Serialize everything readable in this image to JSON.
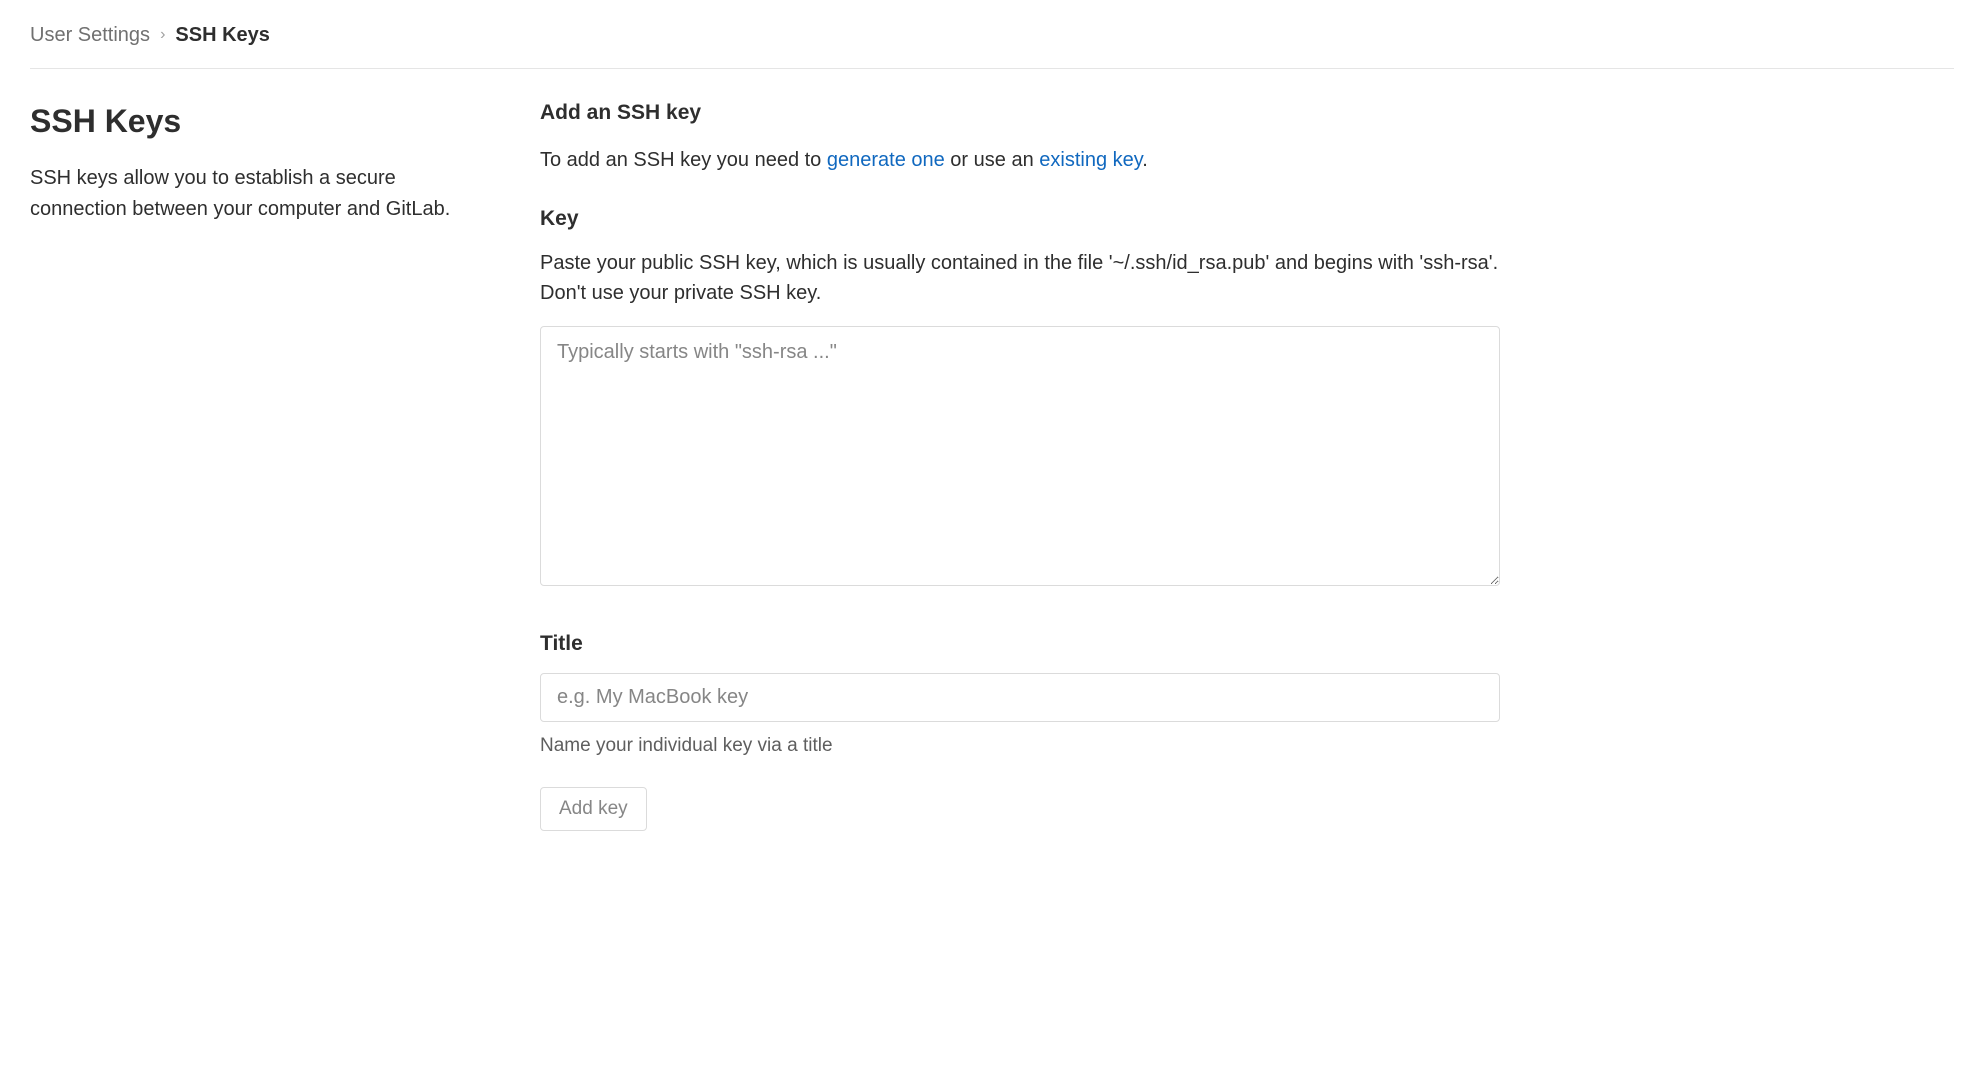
{
  "breadcrumb": {
    "parent": "User Settings",
    "current": "SSH Keys"
  },
  "sidebar": {
    "title": "SSH Keys",
    "description": "SSH keys allow you to establish a secure connection between your computer and GitLab."
  },
  "main": {
    "add_heading": "Add an SSH key",
    "intro_prefix": "To add an SSH key you need to ",
    "intro_link_generate": "generate one",
    "intro_mid": " or use an ",
    "intro_link_existing": "existing key",
    "intro_suffix": ".",
    "key_label": "Key",
    "key_help": "Paste your public SSH key, which is usually contained in the file '~/.ssh/id_rsa.pub' and begins with 'ssh-rsa'. Don't use your private SSH key.",
    "key_placeholder": "Typically starts with \"ssh-rsa ...\"",
    "key_value": "",
    "title_label": "Title",
    "title_placeholder": "e.g. My MacBook key",
    "title_value": "",
    "title_hint": "Name your individual key via a title",
    "submit_label": "Add key"
  }
}
